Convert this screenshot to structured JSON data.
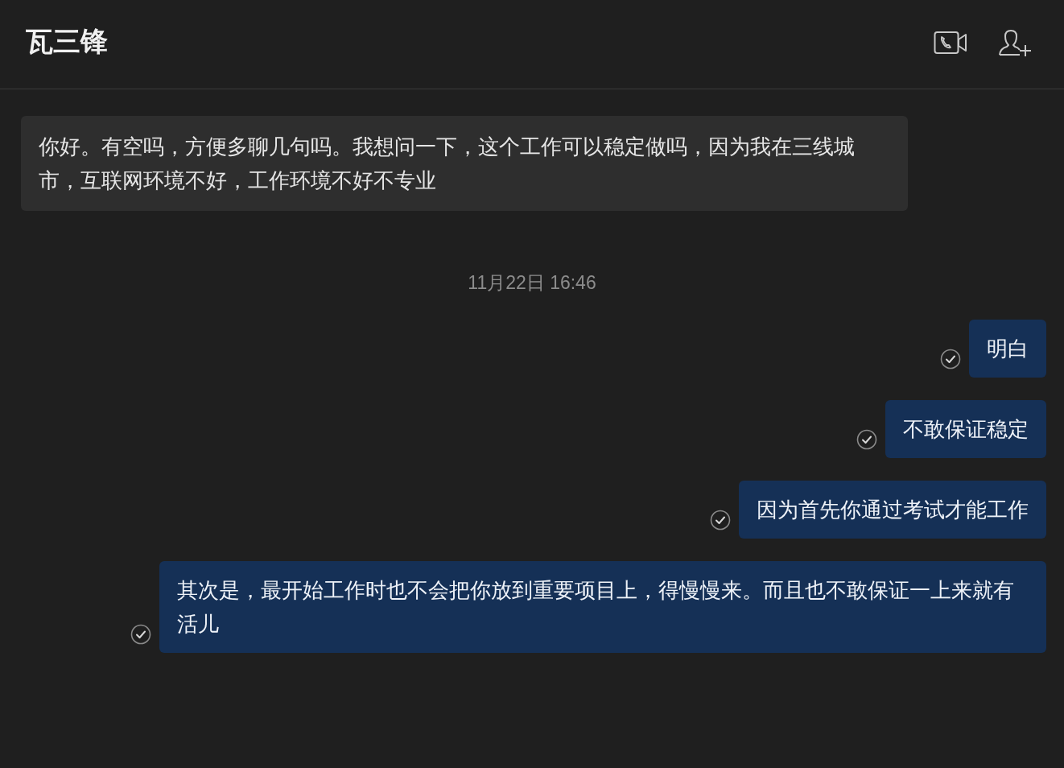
{
  "header": {
    "title": "瓦三锋"
  },
  "messages": [
    {
      "kind": "incoming",
      "text": "你好。有空吗，方便多聊几句吗。我想问一下，这个工作可以稳定做吗，因为我在三线城市，互联网环境不好，工作环境不好不专业"
    },
    {
      "kind": "time",
      "text": "11月22日 16:46"
    },
    {
      "kind": "outgoing",
      "text": "明白"
    },
    {
      "kind": "outgoing",
      "text": "不敢保证稳定"
    },
    {
      "kind": "outgoing",
      "text": "因为首先你通过考试才能工作"
    },
    {
      "kind": "outgoing",
      "text": "其次是，最开始工作时也不会把你放到重要项目上，得慢慢来。而且也不敢保证一上来就有活儿"
    }
  ]
}
